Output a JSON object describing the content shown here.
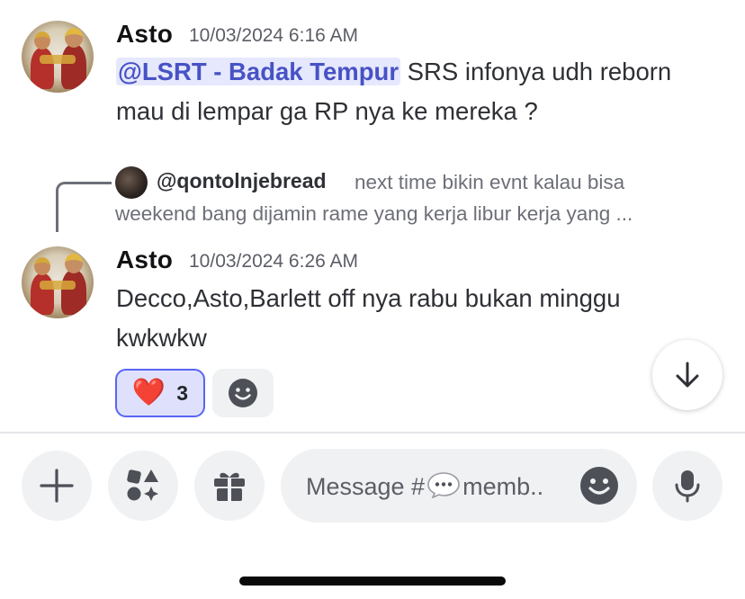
{
  "messages": [
    {
      "author": "Asto",
      "timestamp": "10/03/2024 6:16 AM",
      "mention": "@LSRT - Badak Tempur",
      "line1_rest": " SRS infonya udh reborn",
      "line2": "mau di lempar ga RP nya ke mereka ?"
    },
    {
      "author": "Asto",
      "timestamp": "10/03/2024 6:26 AM",
      "line1": "Decco,Asto,Barlett off nya rabu bukan minggu",
      "line2": "kwkwkw",
      "reply": {
        "user": "@qontolnjebread",
        "text_line1": "next time bikin evnt kalau bisa",
        "text_line2": "weekend bang dijamin rame yang kerja libur kerja yang ..."
      },
      "reactions": [
        {
          "emoji": "❤️",
          "count": "3",
          "icon": "heart-icon",
          "selected": true
        }
      ]
    }
  ],
  "composer": {
    "placeholder_before": "Message #",
    "placeholder_after": "memb..",
    "channel_icon": "speech-bubble-icon"
  },
  "toolbar": {
    "buttons": [
      "plus-icon",
      "apps-icon",
      "gift-icon",
      "microphone-icon"
    ]
  },
  "colors": {
    "accent": "#5865f2",
    "mention_bg": "#e6e8fd",
    "mention_text": "#4752c4",
    "heart": "#e0283e"
  }
}
